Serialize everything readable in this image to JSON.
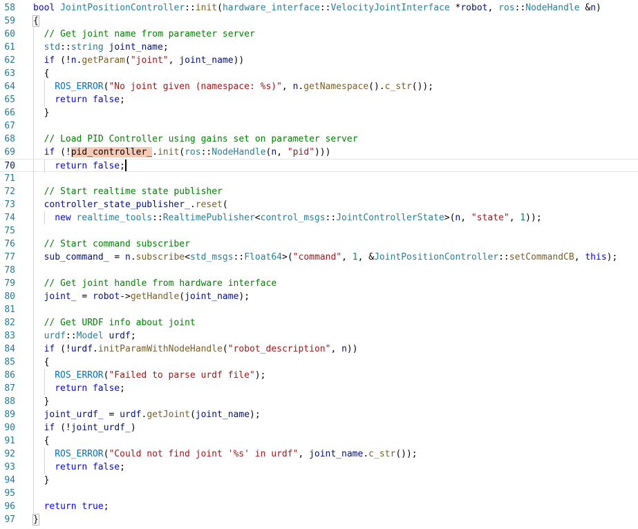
{
  "editor": {
    "current_line": "70",
    "lines": [
      {
        "n": "58",
        "indent": 0,
        "tokens": [
          {
            "t": "bool",
            "c": "kw"
          },
          {
            "t": " ",
            "c": "plain"
          },
          {
            "t": "JointPositionController",
            "c": "ty"
          },
          {
            "t": "::",
            "c": "plain"
          },
          {
            "t": "init",
            "c": "fn"
          },
          {
            "t": "(",
            "c": "plain"
          },
          {
            "t": "hardware_interface",
            "c": "ty"
          },
          {
            "t": "::",
            "c": "plain"
          },
          {
            "t": "VelocityJointInterface",
            "c": "ty"
          },
          {
            "t": " *",
            "c": "plain"
          },
          {
            "t": "robot",
            "c": "var"
          },
          {
            "t": ", ",
            "c": "plain"
          },
          {
            "t": "ros",
            "c": "ty"
          },
          {
            "t": "::",
            "c": "plain"
          },
          {
            "t": "NodeHandle",
            "c": "ty"
          },
          {
            "t": " &",
            "c": "plain"
          },
          {
            "t": "n",
            "c": "var"
          },
          {
            "t": ")",
            "c": "plain"
          }
        ]
      },
      {
        "n": "59",
        "indent": 0,
        "tokens": [
          {
            "t": "{",
            "c": "bm"
          }
        ]
      },
      {
        "n": "60",
        "indent": 1,
        "tokens": [
          {
            "t": "// Get joint name from parameter server",
            "c": "cm"
          }
        ]
      },
      {
        "n": "61",
        "indent": 1,
        "tokens": [
          {
            "t": "std",
            "c": "ty"
          },
          {
            "t": "::",
            "c": "plain"
          },
          {
            "t": "string",
            "c": "ty"
          },
          {
            "t": " ",
            "c": "plain"
          },
          {
            "t": "joint_name",
            "c": "var"
          },
          {
            "t": ";",
            "c": "plain"
          }
        ]
      },
      {
        "n": "62",
        "indent": 1,
        "tokens": [
          {
            "t": "if",
            "c": "kw"
          },
          {
            "t": " (!",
            "c": "plain"
          },
          {
            "t": "n",
            "c": "var"
          },
          {
            "t": ".",
            "c": "plain"
          },
          {
            "t": "getParam",
            "c": "fn"
          },
          {
            "t": "(",
            "c": "plain"
          },
          {
            "t": "\"joint\"",
            "c": "str"
          },
          {
            "t": ", ",
            "c": "plain"
          },
          {
            "t": "joint_name",
            "c": "var"
          },
          {
            "t": "))",
            "c": "plain"
          }
        ]
      },
      {
        "n": "63",
        "indent": 1,
        "tokens": [
          {
            "t": "{",
            "c": "plain"
          }
        ]
      },
      {
        "n": "64",
        "indent": 2,
        "tokens": [
          {
            "t": "ROS_ERROR",
            "c": "mac"
          },
          {
            "t": "(",
            "c": "plain"
          },
          {
            "t": "\"No joint given (namespace: %s)\"",
            "c": "str"
          },
          {
            "t": ", ",
            "c": "plain"
          },
          {
            "t": "n",
            "c": "var"
          },
          {
            "t": ".",
            "c": "plain"
          },
          {
            "t": "getNamespace",
            "c": "fn"
          },
          {
            "t": "().",
            "c": "plain"
          },
          {
            "t": "c_str",
            "c": "fn"
          },
          {
            "t": "());",
            "c": "plain"
          }
        ]
      },
      {
        "n": "65",
        "indent": 2,
        "tokens": [
          {
            "t": "return",
            "c": "kw"
          },
          {
            "t": " ",
            "c": "plain"
          },
          {
            "t": "false",
            "c": "kw"
          },
          {
            "t": ";",
            "c": "plain"
          }
        ]
      },
      {
        "n": "66",
        "indent": 1,
        "tokens": [
          {
            "t": "}",
            "c": "plain"
          }
        ]
      },
      {
        "n": "67",
        "indent": 0,
        "tokens": []
      },
      {
        "n": "68",
        "indent": 1,
        "tokens": [
          {
            "t": "// Load PID Controller using gains set on parameter server",
            "c": "cm"
          }
        ]
      },
      {
        "n": "69",
        "indent": 1,
        "tokens": [
          {
            "t": "if",
            "c": "kw"
          },
          {
            "t": " (!",
            "c": "plain"
          },
          {
            "t": "pid_controller_",
            "c": "hl"
          },
          {
            "t": ".",
            "c": "plain"
          },
          {
            "t": "init",
            "c": "fn"
          },
          {
            "t": "(",
            "c": "plain"
          },
          {
            "t": "ros",
            "c": "ty"
          },
          {
            "t": "::",
            "c": "plain"
          },
          {
            "t": "NodeHandle",
            "c": "ty"
          },
          {
            "t": "(",
            "c": "plain"
          },
          {
            "t": "n",
            "c": "var"
          },
          {
            "t": ", ",
            "c": "plain"
          },
          {
            "t": "\"pid\"",
            "c": "str"
          },
          {
            "t": ")))",
            "c": "plain"
          }
        ]
      },
      {
        "n": "70",
        "indent": 2,
        "caret": true,
        "tokens": [
          {
            "t": "return",
            "c": "kw"
          },
          {
            "t": " ",
            "c": "plain"
          },
          {
            "t": "false",
            "c": "kw"
          },
          {
            "t": ";",
            "c": "plain"
          }
        ]
      },
      {
        "n": "71",
        "indent": 0,
        "tokens": []
      },
      {
        "n": "72",
        "indent": 1,
        "tokens": [
          {
            "t": "// Start realtime state publisher",
            "c": "cm"
          }
        ]
      },
      {
        "n": "73",
        "indent": 1,
        "tokens": [
          {
            "t": "controller_state_publisher_",
            "c": "var"
          },
          {
            "t": ".",
            "c": "plain"
          },
          {
            "t": "reset",
            "c": "fn"
          },
          {
            "t": "(",
            "c": "plain"
          }
        ]
      },
      {
        "n": "74",
        "indent": 2,
        "tokens": [
          {
            "t": "new",
            "c": "kw"
          },
          {
            "t": " ",
            "c": "plain"
          },
          {
            "t": "realtime_tools",
            "c": "ty"
          },
          {
            "t": "::",
            "c": "plain"
          },
          {
            "t": "RealtimePublisher",
            "c": "ty"
          },
          {
            "t": "<",
            "c": "plain"
          },
          {
            "t": "control_msgs",
            "c": "ty"
          },
          {
            "t": "::",
            "c": "plain"
          },
          {
            "t": "JointControllerState",
            "c": "ty"
          },
          {
            "t": ">(",
            "c": "plain"
          },
          {
            "t": "n",
            "c": "var"
          },
          {
            "t": ", ",
            "c": "plain"
          },
          {
            "t": "\"state\"",
            "c": "str"
          },
          {
            "t": ", ",
            "c": "plain"
          },
          {
            "t": "1",
            "c": "num"
          },
          {
            "t": "));",
            "c": "plain"
          }
        ]
      },
      {
        "n": "75",
        "indent": 0,
        "tokens": []
      },
      {
        "n": "76",
        "indent": 1,
        "tokens": [
          {
            "t": "// Start command subscriber",
            "c": "cm"
          }
        ]
      },
      {
        "n": "77",
        "indent": 1,
        "tokens": [
          {
            "t": "sub_command_",
            "c": "var"
          },
          {
            "t": " = ",
            "c": "plain"
          },
          {
            "t": "n",
            "c": "var"
          },
          {
            "t": ".",
            "c": "plain"
          },
          {
            "t": "subscribe",
            "c": "fn"
          },
          {
            "t": "<",
            "c": "plain"
          },
          {
            "t": "std_msgs",
            "c": "ty"
          },
          {
            "t": "::",
            "c": "plain"
          },
          {
            "t": "Float64",
            "c": "ty"
          },
          {
            "t": ">(",
            "c": "plain"
          },
          {
            "t": "\"command\"",
            "c": "str"
          },
          {
            "t": ", ",
            "c": "plain"
          },
          {
            "t": "1",
            "c": "num"
          },
          {
            "t": ", &",
            "c": "plain"
          },
          {
            "t": "JointPositionController",
            "c": "ty"
          },
          {
            "t": "::",
            "c": "plain"
          },
          {
            "t": "setCommandCB",
            "c": "fn"
          },
          {
            "t": ", ",
            "c": "plain"
          },
          {
            "t": "this",
            "c": "kw"
          },
          {
            "t": ");",
            "c": "plain"
          }
        ]
      },
      {
        "n": "78",
        "indent": 0,
        "tokens": []
      },
      {
        "n": "79",
        "indent": 1,
        "tokens": [
          {
            "t": "// Get joint handle from hardware interface",
            "c": "cm"
          }
        ]
      },
      {
        "n": "80",
        "indent": 1,
        "tokens": [
          {
            "t": "joint_",
            "c": "var"
          },
          {
            "t": " = ",
            "c": "plain"
          },
          {
            "t": "robot",
            "c": "var"
          },
          {
            "t": "->",
            "c": "plain"
          },
          {
            "t": "getHandle",
            "c": "fn"
          },
          {
            "t": "(",
            "c": "plain"
          },
          {
            "t": "joint_name",
            "c": "var"
          },
          {
            "t": ");",
            "c": "plain"
          }
        ]
      },
      {
        "n": "81",
        "indent": 0,
        "tokens": []
      },
      {
        "n": "82",
        "indent": 1,
        "tokens": [
          {
            "t": "// Get URDF info about joint",
            "c": "cm"
          }
        ]
      },
      {
        "n": "83",
        "indent": 1,
        "tokens": [
          {
            "t": "urdf",
            "c": "ty"
          },
          {
            "t": "::",
            "c": "plain"
          },
          {
            "t": "Model",
            "c": "ty"
          },
          {
            "t": " ",
            "c": "plain"
          },
          {
            "t": "urdf",
            "c": "var"
          },
          {
            "t": ";",
            "c": "plain"
          }
        ]
      },
      {
        "n": "84",
        "indent": 1,
        "tokens": [
          {
            "t": "if",
            "c": "kw"
          },
          {
            "t": " (!",
            "c": "plain"
          },
          {
            "t": "urdf",
            "c": "var"
          },
          {
            "t": ".",
            "c": "plain"
          },
          {
            "t": "initParamWithNodeHandle",
            "c": "fn"
          },
          {
            "t": "(",
            "c": "plain"
          },
          {
            "t": "\"robot_description\"",
            "c": "str"
          },
          {
            "t": ", ",
            "c": "plain"
          },
          {
            "t": "n",
            "c": "var"
          },
          {
            "t": "))",
            "c": "plain"
          }
        ]
      },
      {
        "n": "85",
        "indent": 1,
        "tokens": [
          {
            "t": "{",
            "c": "plain"
          }
        ]
      },
      {
        "n": "86",
        "indent": 2,
        "tokens": [
          {
            "t": "ROS_ERROR",
            "c": "mac"
          },
          {
            "t": "(",
            "c": "plain"
          },
          {
            "t": "\"Failed to parse urdf file\"",
            "c": "str"
          },
          {
            "t": ");",
            "c": "plain"
          }
        ]
      },
      {
        "n": "87",
        "indent": 2,
        "tokens": [
          {
            "t": "return",
            "c": "kw"
          },
          {
            "t": " ",
            "c": "plain"
          },
          {
            "t": "false",
            "c": "kw"
          },
          {
            "t": ";",
            "c": "plain"
          }
        ]
      },
      {
        "n": "88",
        "indent": 1,
        "tokens": [
          {
            "t": "}",
            "c": "plain"
          }
        ]
      },
      {
        "n": "89",
        "indent": 1,
        "tokens": [
          {
            "t": "joint_urdf_",
            "c": "var"
          },
          {
            "t": " = ",
            "c": "plain"
          },
          {
            "t": "urdf",
            "c": "var"
          },
          {
            "t": ".",
            "c": "plain"
          },
          {
            "t": "getJoint",
            "c": "fn"
          },
          {
            "t": "(",
            "c": "plain"
          },
          {
            "t": "joint_name",
            "c": "var"
          },
          {
            "t": ");",
            "c": "plain"
          }
        ]
      },
      {
        "n": "90",
        "indent": 1,
        "tokens": [
          {
            "t": "if",
            "c": "kw"
          },
          {
            "t": " (!",
            "c": "plain"
          },
          {
            "t": "joint_urdf_",
            "c": "var"
          },
          {
            "t": ")",
            "c": "plain"
          }
        ]
      },
      {
        "n": "91",
        "indent": 1,
        "tokens": [
          {
            "t": "{",
            "c": "plain"
          }
        ]
      },
      {
        "n": "92",
        "indent": 2,
        "tokens": [
          {
            "t": "ROS_ERROR",
            "c": "mac"
          },
          {
            "t": "(",
            "c": "plain"
          },
          {
            "t": "\"Could not find joint '%s' in urdf\"",
            "c": "str"
          },
          {
            "t": ", ",
            "c": "plain"
          },
          {
            "t": "joint_name",
            "c": "var"
          },
          {
            "t": ".",
            "c": "plain"
          },
          {
            "t": "c_str",
            "c": "fn"
          },
          {
            "t": "());",
            "c": "plain"
          }
        ]
      },
      {
        "n": "93",
        "indent": 2,
        "tokens": [
          {
            "t": "return",
            "c": "kw"
          },
          {
            "t": " ",
            "c": "plain"
          },
          {
            "t": "false",
            "c": "kw"
          },
          {
            "t": ";",
            "c": "plain"
          }
        ]
      },
      {
        "n": "94",
        "indent": 1,
        "tokens": [
          {
            "t": "}",
            "c": "plain"
          }
        ]
      },
      {
        "n": "95",
        "indent": 0,
        "tokens": []
      },
      {
        "n": "96",
        "indent": 1,
        "tokens": [
          {
            "t": "return",
            "c": "kw"
          },
          {
            "t": " ",
            "c": "plain"
          },
          {
            "t": "true",
            "c": "kw"
          },
          {
            "t": ";",
            "c": "plain"
          }
        ]
      },
      {
        "n": "97",
        "indent": 0,
        "tokens": [
          {
            "t": "}",
            "c": "bm"
          }
        ]
      }
    ]
  }
}
